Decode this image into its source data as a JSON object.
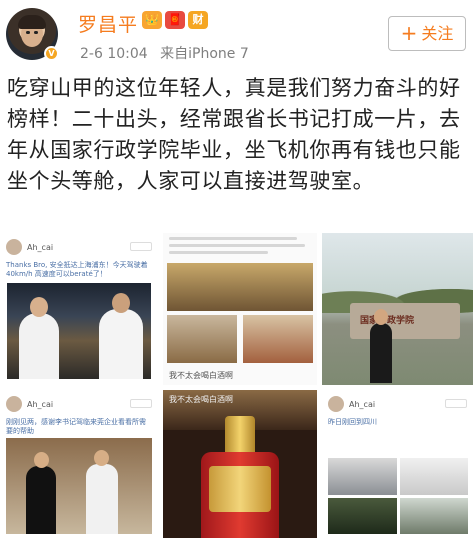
{
  "post": {
    "author": "罗昌平",
    "badges": [
      "👑",
      "🧧",
      "财"
    ],
    "verified_badge": "V",
    "timestamp": "2-6 10:04",
    "source": "来自iPhone 7",
    "follow_label": "关注",
    "follow_icon": "plus-icon",
    "text": "吃穿山甲的这位年轻人，真是我们努力奋斗的好榜样！二十出头，经常跟省长书记打成一片，去年从国家行政学院毕业，坐飞机你再有钱也只能坐个头等舱，人家可以直接进驾驶室。"
  },
  "images": [
    {
      "title": "Ah_cai",
      "caption": "Thanks Bro, 安全抵达上海浦东！今天驾驶着40km/h 高速度可以beraté了！"
    },
    {
      "title": "",
      "caption": "我不太会喝白酒啊"
    },
    {
      "title": "",
      "caption": "国家行政学院"
    },
    {
      "title": "Ah_cai",
      "caption": "刚刚见两，感谢李书记驾临来莞企业看看所需要的帮助"
    },
    {
      "title": "",
      "caption": "我不太会喝白酒啊"
    },
    {
      "title": "Ah_cai",
      "caption": "昨日刚回到四川"
    }
  ],
  "colors": {
    "accent": "#f57c1f",
    "meta": "#7f7f7f",
    "text": "#222222"
  }
}
